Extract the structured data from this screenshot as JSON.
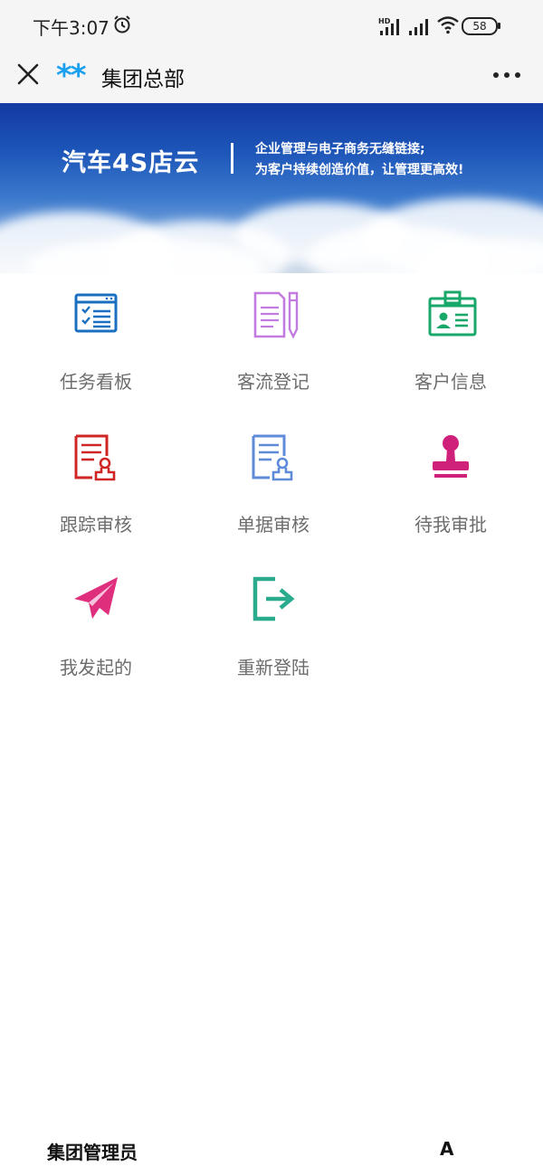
{
  "status_bar": {
    "time": "下午3:07",
    "hd_label": "HD",
    "battery": "58"
  },
  "title_bar": {
    "stars": "**",
    "title": "集团总部"
  },
  "banner": {
    "title": "汽车4S店云",
    "line1": "企业管理与电子商务无缝链接;",
    "line2": "为客户持续创造价值，让管理更高效!"
  },
  "menu": {
    "items": [
      {
        "label": "任务看板",
        "icon": "task-board-icon",
        "color": "#1a6fc0"
      },
      {
        "label": "客流登记",
        "icon": "register-document-icon",
        "color": "#c27be0"
      },
      {
        "label": "客户信息",
        "icon": "id-card-icon",
        "color": "#17a86a"
      },
      {
        "label": "跟踪审核",
        "icon": "stamp-document-icon",
        "color": "#d02525"
      },
      {
        "label": "单据审核",
        "icon": "stamp-document-icon",
        "color": "#5f8ad8"
      },
      {
        "label": "待我审批",
        "icon": "stamp-icon",
        "color": "#d0217a"
      },
      {
        "label": "我发起的",
        "icon": "paper-plane-icon",
        "color": "#de2e7c"
      },
      {
        "label": "重新登陆",
        "icon": "logout-icon",
        "color": "#2aab8d"
      }
    ]
  },
  "footer": {
    "left": "集团管理员",
    "right": "A"
  }
}
